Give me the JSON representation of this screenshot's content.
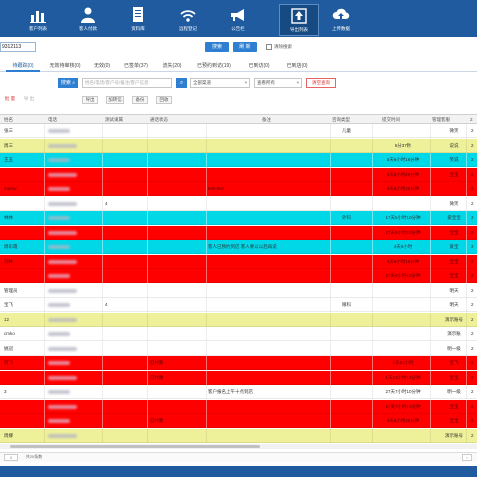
{
  "toolbar": {
    "items": [
      {
        "label": "客户列表",
        "icon": "bar-chart-icon"
      },
      {
        "label": "客人付款",
        "icon": "person-icon"
      },
      {
        "label": "资料库",
        "icon": "document-icon"
      },
      {
        "label": "远程登记",
        "icon": "wifi-icon"
      },
      {
        "label": "公告栏",
        "icon": "megaphone-icon"
      },
      {
        "label": "导出列表",
        "icon": "upload-icon"
      },
      {
        "label": "上传数据",
        "icon": "cloud-upload-icon"
      }
    ]
  },
  "search": {
    "id_value": "9312113",
    "btn1": "搜索",
    "btn2": "刷 新",
    "checkbox_label": "清除搜索"
  },
  "tabs": [
    "待跟踪(0)",
    "无效待审核(0)",
    "无效(0)",
    "已签单(37)",
    "流失(20)",
    "已预约到访(19)",
    "已到访(0)",
    "已到店(0)"
  ],
  "filters": {
    "btn": "搜索 ⌕",
    "keyword_placeholder": "姓名/电话/客户号/备注/客户信息",
    "channel": "全部渠道",
    "owner": "查看所有",
    "reset": "清空查询"
  },
  "actions": [
    "批 量",
    "导 出",
    "导出",
    "加转信",
    "备份",
    "回收"
  ],
  "columns": [
    "姓名",
    "电话",
    "测试隶属",
    "通话状态",
    "备注",
    "咨询类型",
    "提交时间",
    "管理客服",
    "2"
  ],
  "colors": {
    "red": "#ff0000",
    "cyan": "#00d8e8",
    "yellow": "#eef09a",
    "white": "#ffffff",
    "brand": "#1f5b9e"
  },
  "rows": [
    {
      "color": "white",
      "name": "张三",
      "amount": "",
      "status": "",
      "note": "",
      "type": "儿童",
      "time": "",
      "owner": "微笑",
      "last": "2"
    },
    {
      "color": "yellow",
      "name": "周三",
      "amount": "",
      "status": "",
      "note": "",
      "type": "",
      "time": "6分37秒",
      "owner": "说说",
      "last": "2"
    },
    {
      "color": "cyan",
      "name": "王五",
      "amount": "",
      "status": "",
      "note": "",
      "type": "",
      "time": "5天6小时16分钟",
      "owner": "笑说",
      "last": "2"
    },
    {
      "color": "red",
      "name": "",
      "amount": "",
      "status": "",
      "note": "",
      "type": "",
      "time": "5天6小时26分钟",
      "owner": "宝宝",
      "last": "2"
    },
    {
      "color": "red",
      "name": "mumu",
      "amount": "",
      "status": "",
      "note": "test test",
      "type": "",
      "time": "5天6小时26分钟",
      "owner": "",
      "last": "2"
    },
    {
      "color": "white",
      "name": "",
      "amount": "4",
      "status": "",
      "note": "",
      "type": "",
      "time": "",
      "owner": "微笑",
      "last": "2"
    },
    {
      "color": "cyan",
      "name": "林林",
      "amount": "",
      "status": "",
      "note": "",
      "type": "外科",
      "time": "17天5小时10分钟",
      "owner": "爱宝宝",
      "last": "2"
    },
    {
      "color": "red",
      "name": "",
      "amount": "",
      "status": "",
      "note": "",
      "type": "",
      "time": "17天5小时10分钟",
      "owner": "宝宝",
      "last": "2"
    },
    {
      "color": "cyan",
      "name": "周彩霞",
      "amount": "",
      "status": "",
      "note": "客人已预约到店 客人要以以后再说",
      "type": "",
      "time": "4天6小时",
      "owner": "爱宝",
      "last": "2"
    },
    {
      "color": "red",
      "name": "刘林",
      "amount": "",
      "status": "",
      "note": "",
      "type": "",
      "time": "5天6小时16分钟",
      "owner": "宝宝",
      "last": "2"
    },
    {
      "color": "red",
      "name": "",
      "amount": "",
      "status": "",
      "note": "",
      "type": "",
      "time": "27天5小时10分钟",
      "owner": "宝宝",
      "last": "2"
    },
    {
      "color": "white",
      "name": "管理员",
      "amount": "",
      "status": "",
      "note": "",
      "type": "",
      "time": "",
      "owner": "明天",
      "last": "2"
    },
    {
      "color": "white",
      "name": "宝飞",
      "amount": "4",
      "status": "",
      "note": "",
      "type": "眼科",
      "time": "",
      "owner": "明天",
      "last": "2"
    },
    {
      "color": "yellow",
      "name": "12",
      "amount": "",
      "status": "",
      "note": "",
      "type": "",
      "time": "",
      "owner": "演示账号",
      "last": "2"
    },
    {
      "color": "white",
      "name": "cmko",
      "amount": "",
      "status": "",
      "note": "",
      "type": "",
      "time": "",
      "owner": "演示账",
      "last": "2"
    },
    {
      "color": "white",
      "name": "姚冠",
      "amount": "",
      "status": "",
      "note": "",
      "type": "",
      "time": "",
      "owner": "明一级",
      "last": "2"
    },
    {
      "color": "red",
      "name": "何飞",
      "amount": "",
      "status": "已付款",
      "note": "",
      "type": "",
      "time": "1天21小时",
      "owner": "宝飞",
      "last": "2"
    },
    {
      "color": "red",
      "name": "",
      "amount": "",
      "status": "已付款",
      "note": "",
      "type": "",
      "time": "1天21小时13分钟",
      "owner": "宝宝",
      "last": "2"
    },
    {
      "color": "white",
      "name": "3",
      "amount": "",
      "status": "",
      "note": "客户报名上午十点到店",
      "type": "",
      "time": "27天7小时10分钟",
      "owner": "明一级",
      "last": "2"
    },
    {
      "color": "red",
      "name": "",
      "amount": "",
      "status": "",
      "note": "",
      "type": "",
      "time": "27天7小时10分钟",
      "owner": "宝宝",
      "last": "2"
    },
    {
      "color": "red",
      "name": "",
      "amount": "",
      "status": "已付款",
      "note": "",
      "type": "",
      "time": "5天6小时26分钟",
      "owner": "宝宝",
      "last": "2"
    },
    {
      "color": "yellow",
      "name": "周娜",
      "amount": "",
      "status": "",
      "note": "",
      "type": "",
      "time": "",
      "owner": "演示账号",
      "last": "2"
    }
  ],
  "pager": {
    "per_page": "1",
    "info": "共20条数"
  }
}
